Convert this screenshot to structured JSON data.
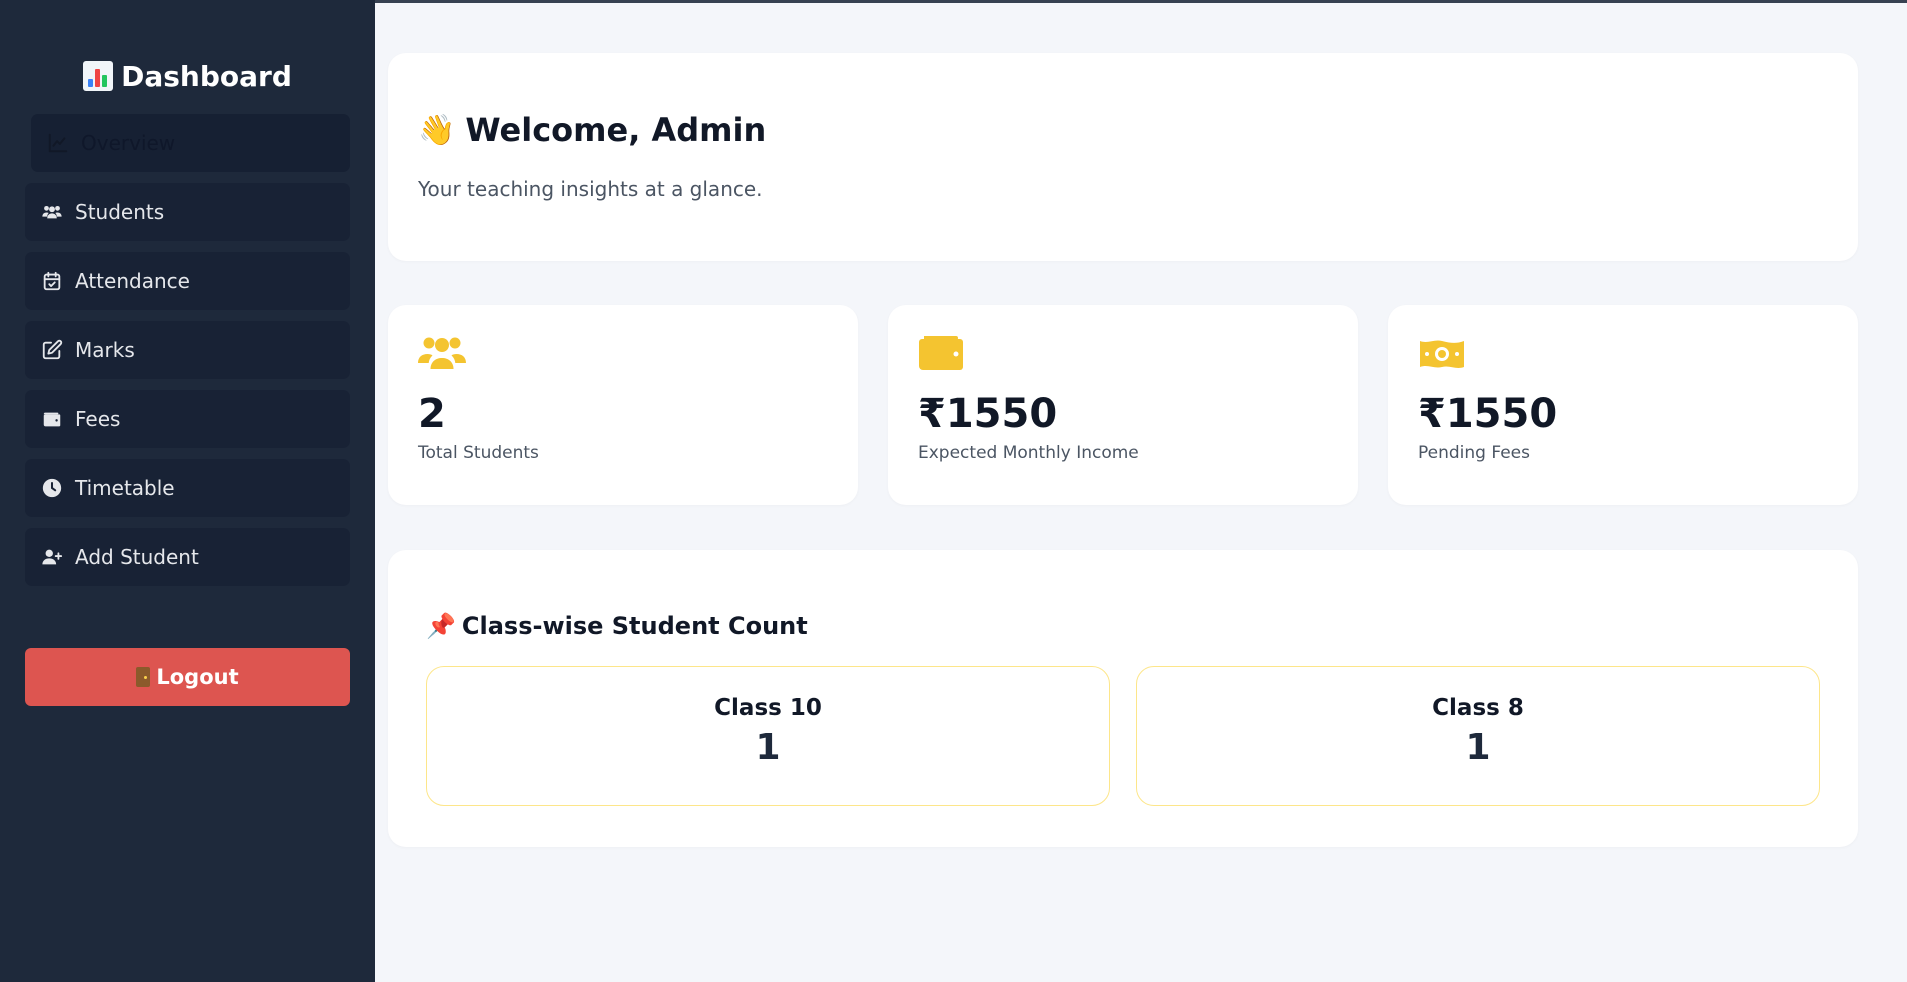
{
  "sidebar": {
    "brand": "Dashboard",
    "brand_icon": "bar-chart-icon",
    "items": [
      {
        "label": "Overview",
        "icon": "line-chart-icon"
      },
      {
        "label": "Students",
        "icon": "users-icon"
      },
      {
        "label": "Attendance",
        "icon": "calendar-check-icon"
      },
      {
        "label": "Marks",
        "icon": "edit-icon"
      },
      {
        "label": "Fees",
        "icon": "wallet-icon"
      },
      {
        "label": "Timetable",
        "icon": "clock-icon"
      },
      {
        "label": "Add Student",
        "icon": "user-plus-icon"
      }
    ],
    "logout": "Logout"
  },
  "welcome": {
    "title": "Welcome, Admin",
    "subtitle": "Your teaching insights at a glance."
  },
  "stats": [
    {
      "value": "2",
      "label": "Total Students",
      "icon": "users-icon"
    },
    {
      "value": "₹1550",
      "label": "Expected Monthly Income",
      "icon": "wallet-icon"
    },
    {
      "value": "₹1550",
      "label": "Pending Fees",
      "icon": "money-bill-icon"
    }
  ],
  "class_section": {
    "title": "Class-wise Student Count",
    "classes": [
      {
        "name": "Class 10",
        "count": "1"
      },
      {
        "name": "Class 8",
        "count": "1"
      }
    ]
  },
  "colors": {
    "sidebar_bg": "#1e293b",
    "accent": "#f4c430",
    "logout": "#dd5550",
    "page_bg": "#f4f6fa"
  }
}
